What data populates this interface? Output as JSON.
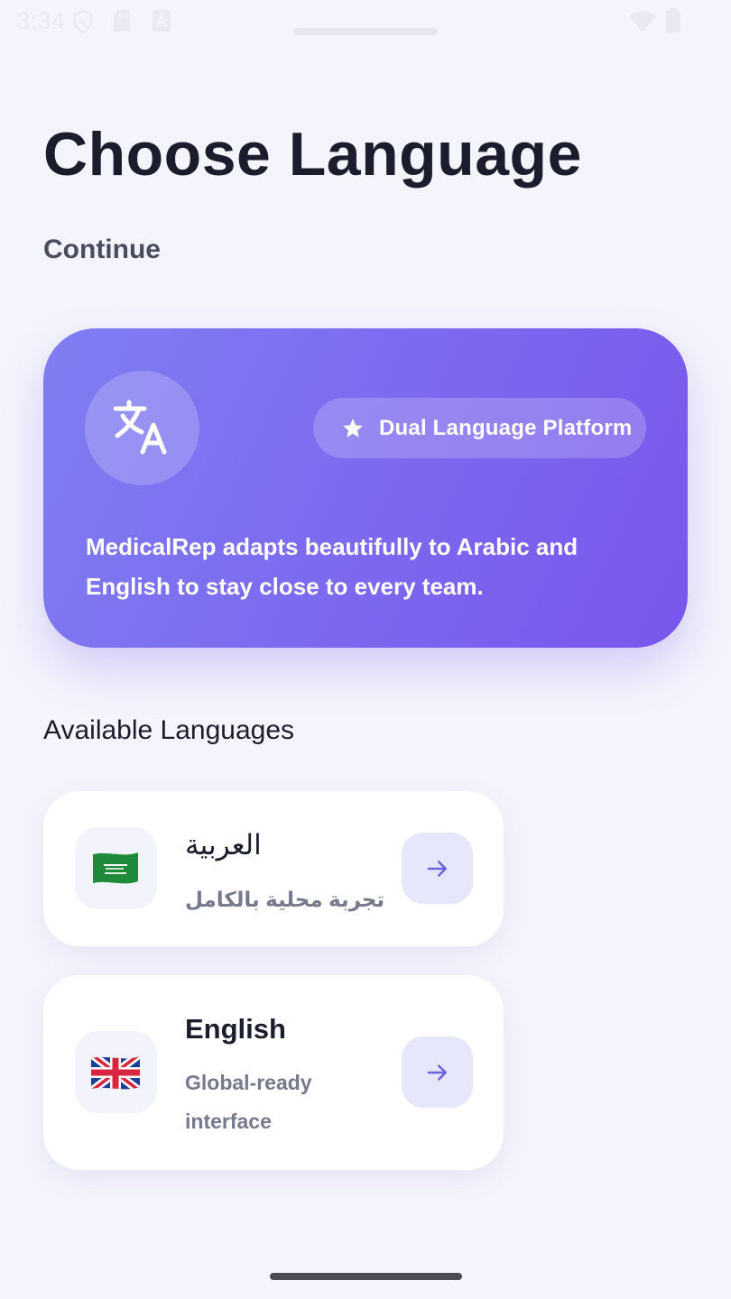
{
  "status_bar": {
    "time": "3:34",
    "icons": [
      "shield-icon",
      "sd-card-icon",
      "font-a-icon",
      "wifi-icon",
      "battery-icon"
    ]
  },
  "header": {
    "title": "Choose Language",
    "subtitle": "Continue"
  },
  "hero": {
    "icon": "translate-icon",
    "badge_icon": "star-icon",
    "badge_label": "Dual Language Platform",
    "description": "MedicalRep adapts beautifully to Arabic and English to stay close to every team."
  },
  "languages_section": {
    "heading": "Available Languages",
    "items": [
      {
        "name": "العربية",
        "subtitle": "تجربة محلية بالكامل",
        "flag": "saudi-flag-icon",
        "action_icon": "arrow-right-icon"
      },
      {
        "name": "English",
        "subtitle": "Global-ready interface",
        "flag": "uk-flag-icon",
        "action_icon": "arrow-right-icon"
      }
    ]
  },
  "colors": {
    "background": "#f4f4fc",
    "hero_gradient_start": "#7f7ef2",
    "hero_gradient_end": "#7a56ec",
    "accent": "#6c63e0",
    "arrow_button_bg": "#e7e7fb"
  }
}
